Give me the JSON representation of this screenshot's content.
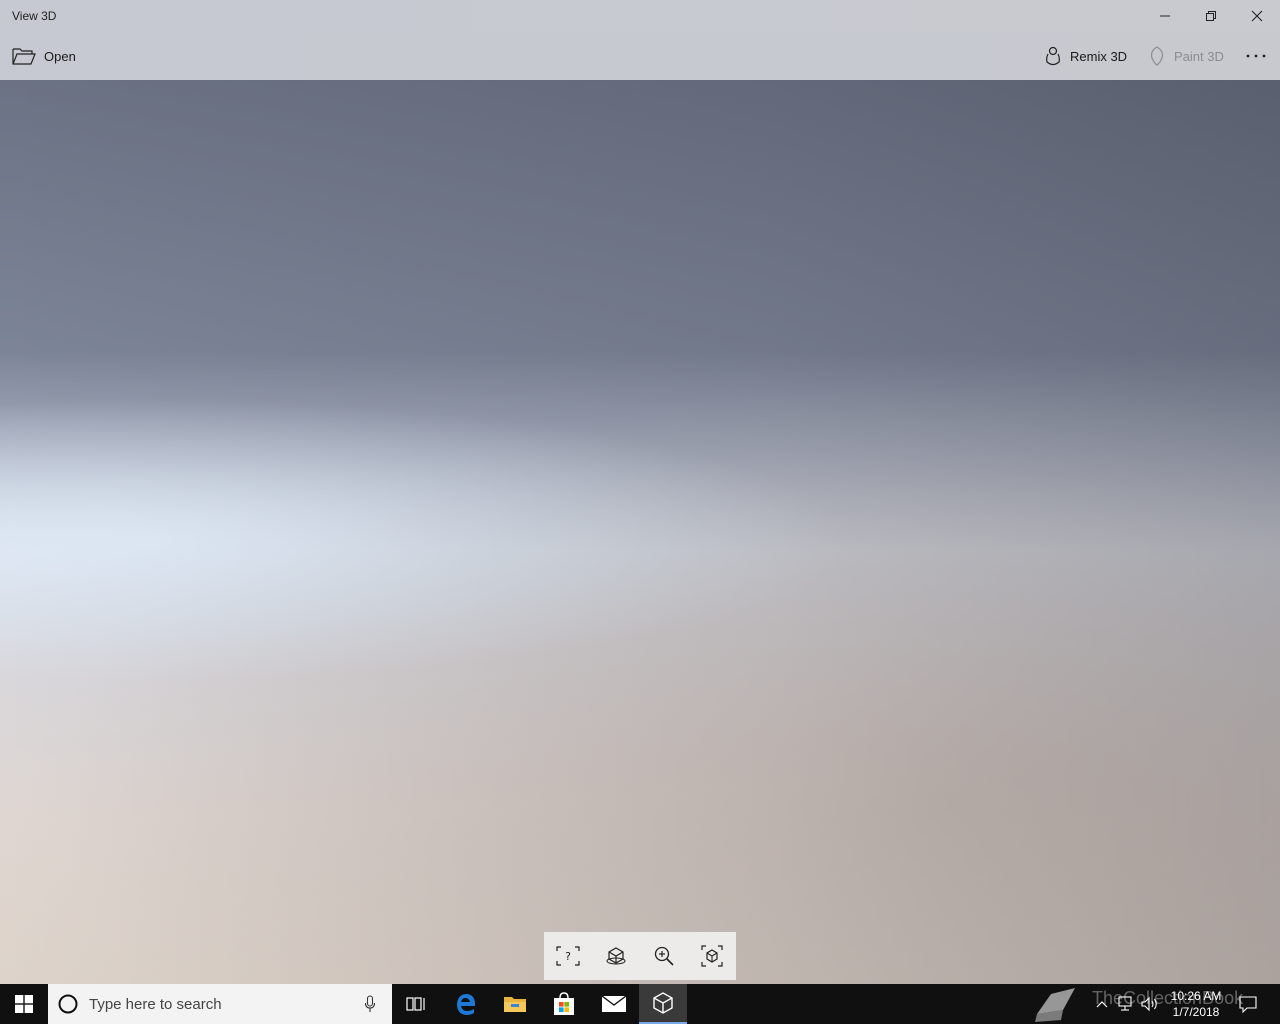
{
  "window": {
    "title": "View 3D"
  },
  "toolbar": {
    "open_label": "Open",
    "remix_label": "Remix 3D",
    "paint_label": "Paint 3D",
    "more_label": "..."
  },
  "taskbar": {
    "search_placeholder": "Type here to search",
    "time": "10:26 AM",
    "date": "1/7/2018",
    "watermark": "TheCollectionBook"
  },
  "icons": {
    "open": "folder-open-icon",
    "remix": "remix3d-icon",
    "paint": "paint3d-icon",
    "more": "more-icon",
    "minimize": "minimize-icon",
    "maximize": "restore-icon",
    "close": "close-icon",
    "float": [
      "help-frame-icon",
      "environment-icon",
      "zoom-in-icon",
      "reset-view-icon"
    ]
  },
  "colors": {
    "taskbar": "#101010",
    "accent": "#78a9e6",
    "chrome": "#c6c9d1"
  }
}
